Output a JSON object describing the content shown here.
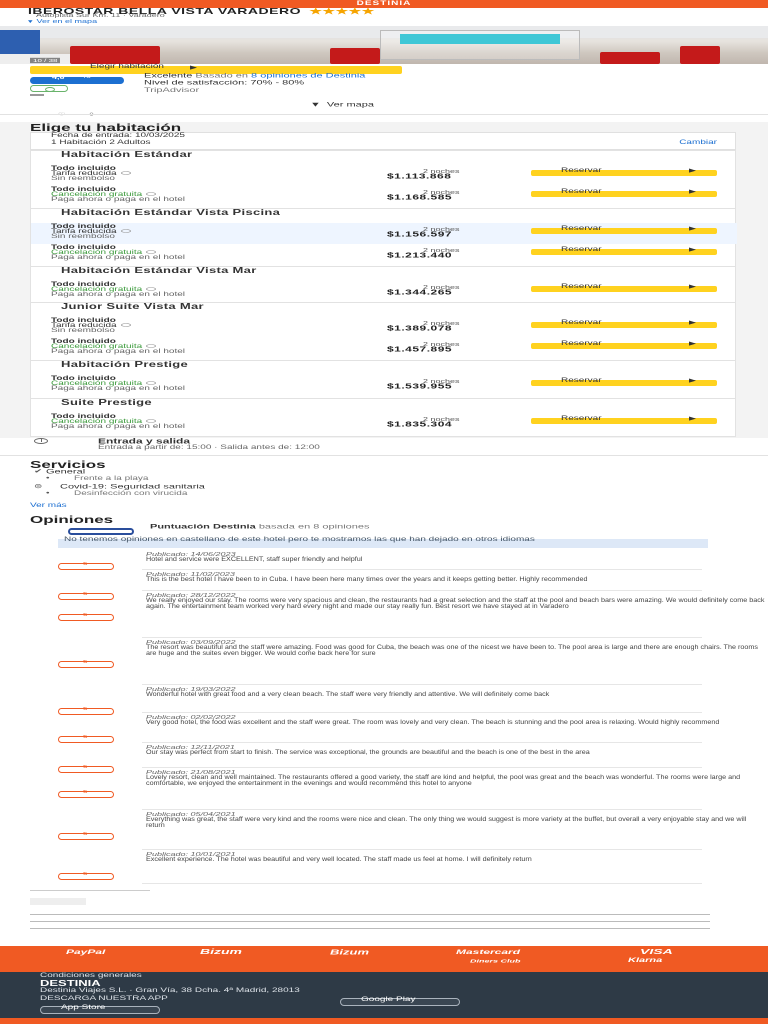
{
  "header": {
    "brand": "DESTINIA",
    "hotel_name": "IBEROSTAR BELLA VISTA VARADERO",
    "stars": "★★★★★",
    "address": "Autopista Sur Km. 11 · Varadero",
    "map_link": "Ver en el mapa"
  },
  "photo": {
    "counter": "10 / 38"
  },
  "rating": {
    "choose_button": "Elegir habitación",
    "score": "4,6",
    "scale": "/5",
    "label": "Excelente",
    "opinions_prefix": "Basado en",
    "opinions_link": "8 opiniones de Destinia",
    "recommend": "Nivel de satisfacción: 70% - 80%",
    "tripadvisor": "TripAdvisor",
    "view_map": "Ver mapa"
  },
  "rooms": {
    "title": "Elige tu habitación",
    "dates_line1": "Fecha de entrada: 10/03/2025",
    "dates_line2": "1 Habitación 2 Adultos",
    "change": "Cambiar",
    "nights_label": "2 noches",
    "reserve_label": "Reservar",
    "list": [
      {
        "name": "Habitación Estándar",
        "options": [
          {
            "title": "Todo incluido",
            "line2": "Tarifa reducida",
            "line3": "Sin reembolso",
            "price": "$1.113.868",
            "green": false
          },
          {
            "title": "Todo incluido",
            "line2": "Cancelación gratuita",
            "line3": "Paga ahora o paga en el hotel",
            "price": "$1.168.585",
            "green": true
          }
        ]
      },
      {
        "name": "Habitación Estándar Vista Piscina",
        "options": [
          {
            "title": "Todo incluido",
            "line2": "Tarifa reducida",
            "line3": "Sin reembolso",
            "price": "$1.156.597",
            "green": false
          },
          {
            "title": "Todo incluido",
            "line2": "Cancelación gratuita",
            "line3": "Paga ahora o paga en el hotel",
            "price": "$1.213.440",
            "green": true
          }
        ]
      },
      {
        "name": "Habitación Estándar Vista Mar",
        "options": [
          {
            "title": "Todo incluido",
            "line2": "Cancelación gratuita",
            "line3": "Paga ahora o paga en el hotel",
            "price": "$1.344.265",
            "green": true
          }
        ]
      },
      {
        "name": "Junior Suite Vista Mar",
        "options": [
          {
            "title": "Todo incluido",
            "line2": "Tarifa reducida",
            "line3": "Sin reembolso",
            "price": "$1.389.078",
            "green": false
          },
          {
            "title": "Todo incluido",
            "line2": "Cancelación gratuita",
            "line3": "Paga ahora o paga en el hotel",
            "price": "$1.457.895",
            "green": true
          }
        ]
      },
      {
        "name": "Habitación Prestige",
        "options": [
          {
            "title": "Todo incluido",
            "line2": "Cancelación gratuita",
            "line3": "Paga ahora o paga en el hotel",
            "price": "$1.539.955",
            "green": true
          }
        ]
      },
      {
        "name": "Suite Prestige",
        "options": [
          {
            "title": "Todo incluido",
            "line2": "Cancelación gratuita",
            "line3": "Paga ahora o paga en el hotel",
            "price": "$1.835.304",
            "green": true
          }
        ]
      }
    ]
  },
  "checkin": {
    "title": "Entrada y salida",
    "line": "Entrada a partir de: 15:00 · Salida antes de: 12:00"
  },
  "services": {
    "title": "Servicios",
    "general": "General",
    "general_sub": "Frente a la playa",
    "covid": "Covid-19: Seguridad sanitaria",
    "covid_sub": "Desinfección con virucida",
    "more": "Ver más"
  },
  "opinions": {
    "title": "Opiniones",
    "brand_label": "Puntuación Destinia",
    "based_on": "basada en 8 opiniones",
    "note": "No tenemos opiniones en castellano de este hotel pero te mostramos las que han dejado en otros idiomas",
    "reviews": [
      {
        "score": "5",
        "date": "Publicado: 14/06/2023",
        "text": "Hotel and service were EXCELLENT, staff super friendly and helpful"
      },
      {
        "score": "5",
        "date": "Publicado: 11/02/2023",
        "text": "This is the best hotel I have been to in Cuba. I have been here many times over the years and it keeps getting better. Highly recommended"
      },
      {
        "score": "5",
        "date": "Publicado: 28/12/2022",
        "text": "We really enjoyed our stay. The rooms were very spacious and clean, the restaurants had a great selection and the staff at the pool and beach bars were amazing. We would definitely come back again. The entertainment team worked very hard every night and made our stay really fun. Best resort we have stayed at in Varadero"
      },
      {
        "score": "5",
        "date": "Publicado: 03/09/2022",
        "text": "The resort was beautiful and the staff were amazing. Food was good for Cuba, the beach was one of the nicest we have been to. The pool area is large and there are enough chairs. The rooms are huge and the suites even bigger. We would come back here for sure"
      },
      {
        "score": "5",
        "date": "Publicado: 19/03/2022",
        "text": "Wonderful hotel with great food and a very clean beach. The staff were very friendly and attentive. We will definitely come back"
      },
      {
        "score": "5",
        "date": "Publicado: 02/02/2022",
        "text": "Very good hotel, the food was excellent and the staff were great. The room was lovely and very clean. The beach is stunning and the pool area is relaxing. Would highly recommend"
      },
      {
        "score": "5",
        "date": "Publicado: 12/11/2021",
        "text": "Our stay was perfect from start to finish. The service was exceptional, the grounds are beautiful and the beach is one of the best in the area"
      },
      {
        "score": "5",
        "date": "Publicado: 21/08/2021",
        "text": "Lovely resort, clean and well maintained. The restaurants offered a good variety, the staff are kind and helpful, the pool was great and the beach was wonderful. The rooms were large and comfortable, we enjoyed the entertainment in the evenings and would recommend this hotel to anyone"
      },
      {
        "score": "5",
        "date": "Publicado: 05/04/2021",
        "text": "Everything was great, the staff were very kind and the rooms were nice and clean. The only thing we would suggest is more variety at the buffet, but overall a very enjoyable stay and we will return"
      },
      {
        "score": "5",
        "date": "Publicado: 10/01/2021",
        "text": "Excellent experience. The hotel was beautiful and very well located. The staff made us feel at home. I will definitely return"
      }
    ]
  },
  "footer": {
    "payments": [
      "PayPal",
      "Bizum",
      "Mastercard",
      "VISA",
      "Diners Club",
      "Klarna"
    ],
    "conditions": "Condiciones generales",
    "brand": "DESTINIA",
    "company": "Destinia Viajes S.L. · Gran Vía, 38 Dcha. 4ª Madrid, 28013",
    "app_title": "DESCARGA NUESTRA APP",
    "app_store": "App Store",
    "google_play": "Google Play"
  }
}
